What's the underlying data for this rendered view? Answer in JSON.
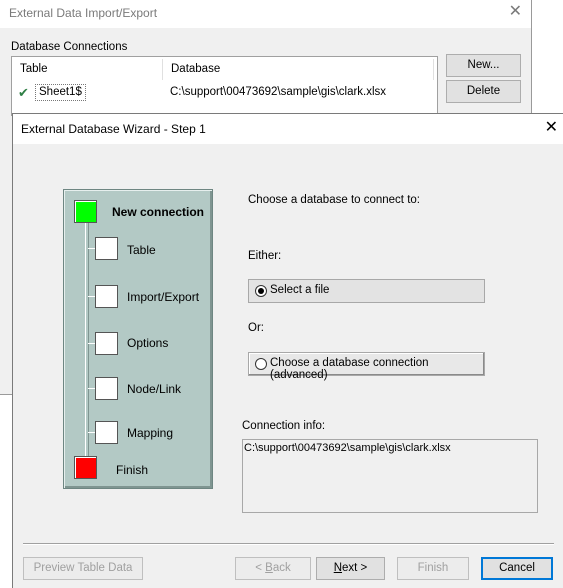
{
  "background_dialog": {
    "title": "External Data Import/Export",
    "close_glyph": "✕",
    "group_label": "Database Connections",
    "columns": [
      "Table",
      "Database"
    ],
    "rows": [
      {
        "table": "Sheet1$",
        "database": "C:\\support\\00473692\\sample\\gis\\clark.xlsx"
      }
    ],
    "buttons": {
      "new": "New...",
      "delete": "Delete"
    }
  },
  "wizard": {
    "title": "External Database Wizard - Step 1",
    "close_glyph": "✕",
    "steps": [
      {
        "label": "New connection",
        "state": "current"
      },
      {
        "label": "Table",
        "state": "pending"
      },
      {
        "label": "Import/Export",
        "state": "pending"
      },
      {
        "label": "Options",
        "state": "pending"
      },
      {
        "label": "Node/Link",
        "state": "pending"
      },
      {
        "label": "Mapping",
        "state": "pending"
      },
      {
        "label": "Finish",
        "state": "end"
      }
    ],
    "prompt": "Choose a database to connect to:",
    "either_label": "Either:",
    "or_label": "Or:",
    "options": {
      "select_file": {
        "label": "Select a file",
        "selected": true
      },
      "db_connection": {
        "label": "Choose a database connection (advanced)",
        "selected": false
      }
    },
    "connection_info_label": "Connection info:",
    "connection_info_value": "C:\\support\\00473692\\sample\\gis\\clark.xlsx",
    "buttons": {
      "preview": "Preview Table Data",
      "back_prefix": "< ",
      "back_key": "B",
      "back_rest": "ack",
      "next_key": "N",
      "next_rest": "ext >",
      "finish": "Finish",
      "cancel": "Cancel"
    },
    "colors": {
      "current_step": "#00ff00",
      "end_step": "#ff0000",
      "panel": "#b3c9c5"
    }
  }
}
